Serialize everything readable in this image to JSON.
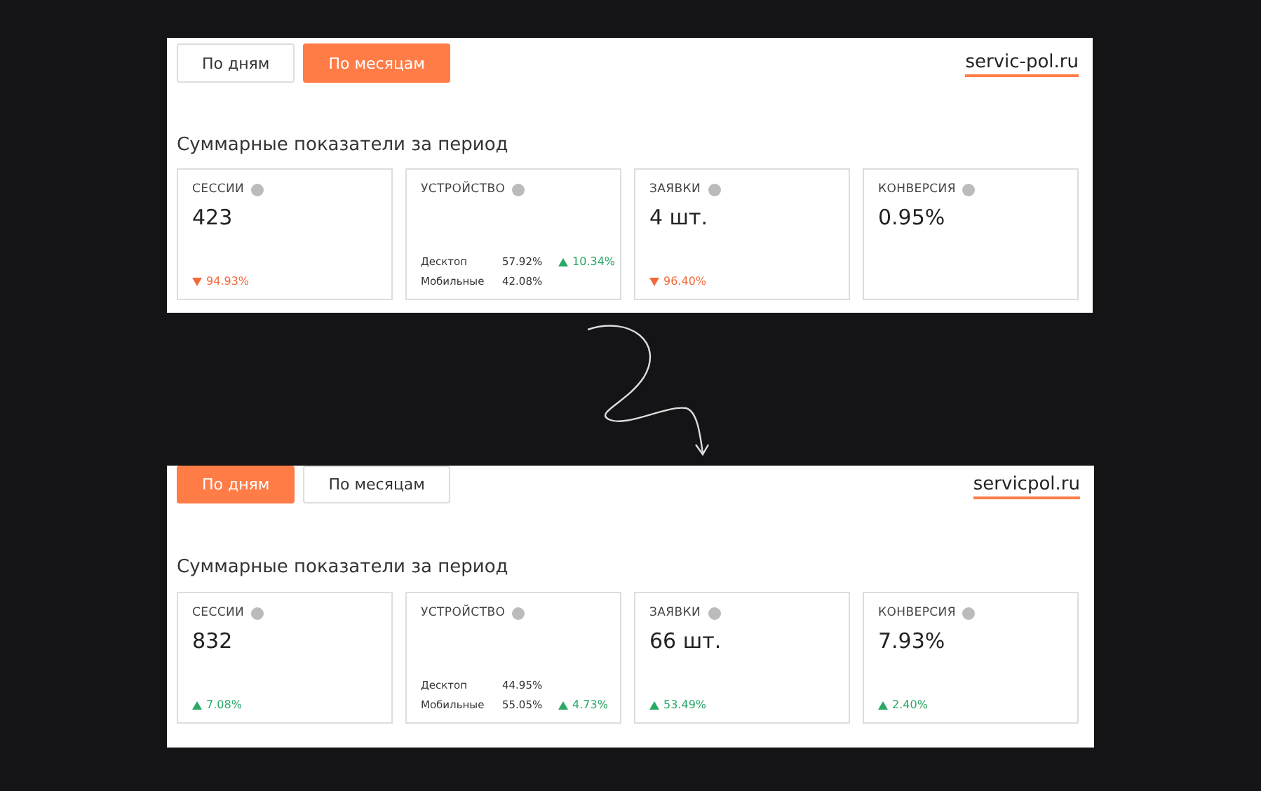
{
  "panels": [
    {
      "tabs": [
        {
          "label": "По дням",
          "selected": false
        },
        {
          "label": "По месяцам",
          "selected": true
        }
      ],
      "site": "servic-pol.ru",
      "heading": "Суммарные показатели за период",
      "cards": [
        {
          "kind": "metric",
          "title": "СЕССИИ",
          "value": "423",
          "delta": {
            "text": "94.93%",
            "rising": false
          }
        },
        {
          "kind": "devices",
          "title": "УСТРОЙСТВО",
          "rows": [
            {
              "label": "Десктоп",
              "share": "57.92%",
              "delta": {
                "text": "10.34%",
                "rising": true
              }
            },
            {
              "label": "Мобильные",
              "share": "42.08%"
            }
          ]
        },
        {
          "kind": "metric",
          "title": "ЗАЯВКИ",
          "value": "4 шт.",
          "delta": {
            "text": "96.40%",
            "rising": false
          }
        },
        {
          "kind": "metric",
          "title": "КОНВЕРСИЯ",
          "value": "0.95%"
        }
      ]
    },
    {
      "tabs": [
        {
          "label": "По дням",
          "selected": true
        },
        {
          "label": "По месяцам",
          "selected": false
        }
      ],
      "site": "servicpol.ru",
      "heading": "Суммарные показатели за период",
      "cards": [
        {
          "kind": "metric",
          "title": "СЕССИИ",
          "value": "832",
          "delta": {
            "text": "7.08%",
            "rising": true
          }
        },
        {
          "kind": "devices",
          "title": "УСТРОЙСТВО",
          "rows": [
            {
              "label": "Десктоп",
              "share": "44.95%"
            },
            {
              "label": "Мобильные",
              "share": "55.05%",
              "delta": {
                "text": "4.73%",
                "rising": true
              }
            }
          ]
        },
        {
          "kind": "metric",
          "title": "ЗАЯВКИ",
          "value": "66 шт.",
          "delta": {
            "text": "53.49%",
            "rising": true
          }
        },
        {
          "kind": "metric",
          "title": "КОНВЕРСИЯ",
          "value": "7.93%",
          "delta": {
            "text": "2.40%",
            "rising": true
          }
        }
      ]
    }
  ]
}
